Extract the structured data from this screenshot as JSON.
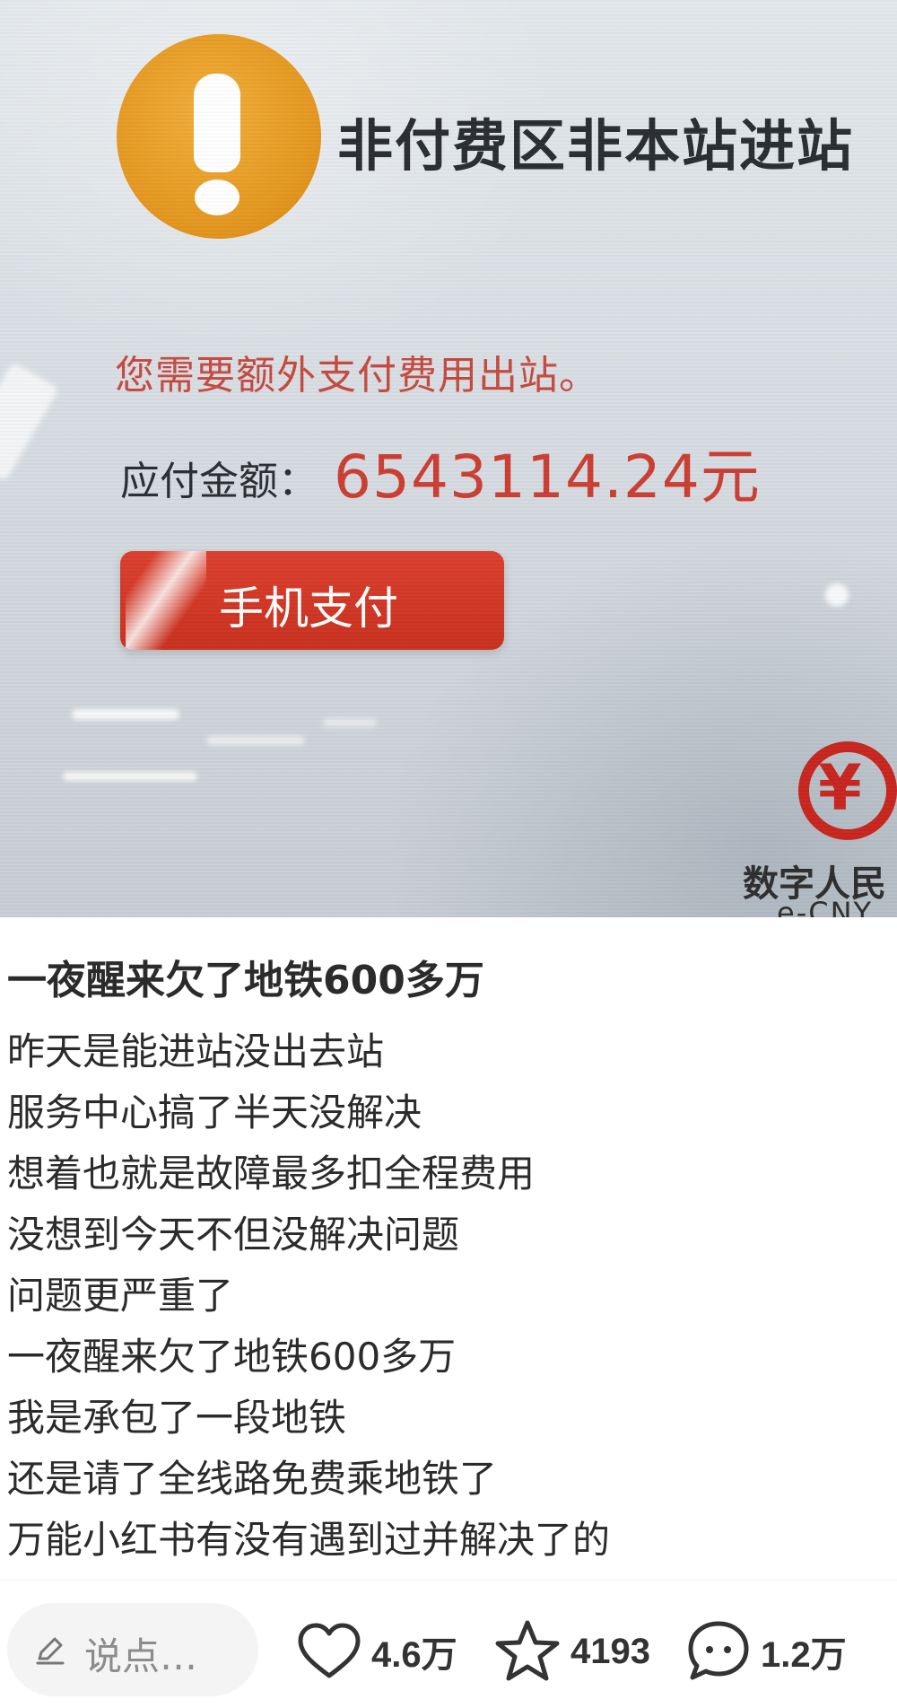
{
  "photo": {
    "screen_title": "非付费区非本站进站",
    "message": "您需要额外支付费用出站。",
    "amount_label": "应付金额：",
    "amount_value": "6543114.24元",
    "pay_button_label": "手机支付",
    "ecny_text": "数字人民",
    "ecny_sub": "e-CNY",
    "colors": {
      "warning": "#e59a22",
      "alert_text": "#cc3e33",
      "button": "#d23a29",
      "ecny": "#c8261f"
    }
  },
  "post": {
    "title": "一夜醒来欠了地铁600多万",
    "lines": [
      "昨天是能进站没出去站",
      "服务中心搞了半天没解决",
      "想着也就是故障最多扣全程费用",
      "没想到今天不但没解决问题",
      "问题更严重了",
      "一夜醒来欠了地铁600多万",
      "我是承包了一段地铁",
      "还是请了全线路免费乘地铁了",
      "万能小红书有没有遇到过并解决了的"
    ]
  },
  "bottom_bar": {
    "comment_placeholder": "说点…",
    "comment_icon": "pencil-icon",
    "likes": {
      "icon": "heart-icon",
      "count": "4.6万"
    },
    "favorites": {
      "icon": "star-icon",
      "count": "4193"
    },
    "comments": {
      "icon": "chat-bubble-icon",
      "count": "1.2万"
    }
  }
}
